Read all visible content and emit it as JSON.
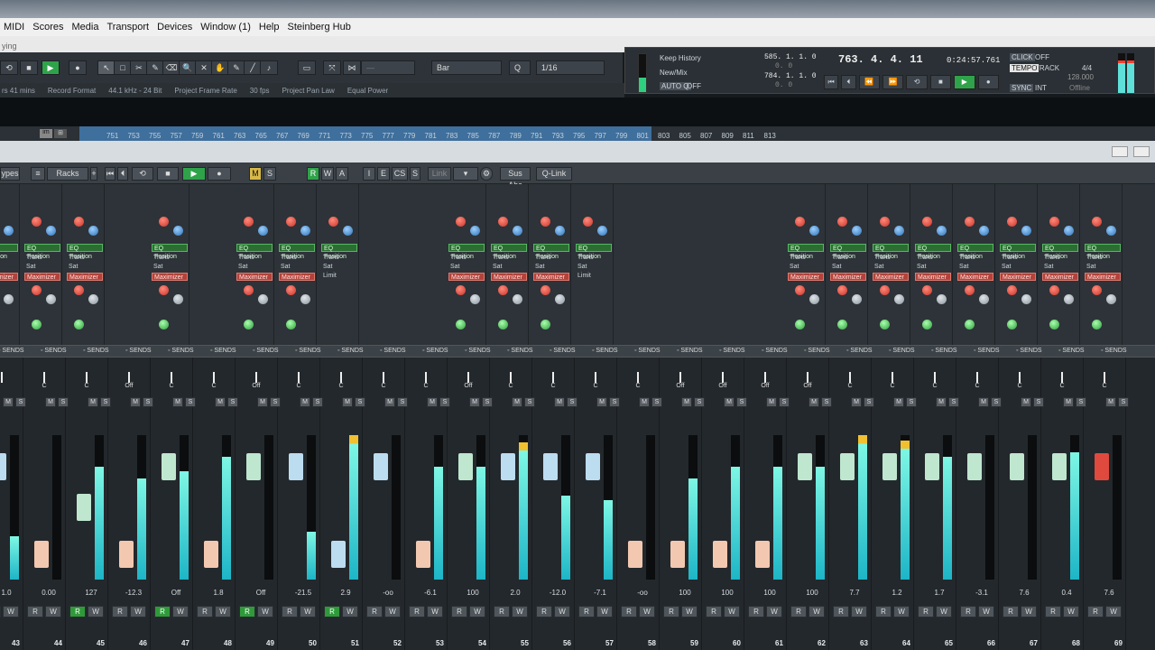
{
  "menu": [
    "MIDI",
    "Scores",
    "Media",
    "Transport",
    "Devices",
    "Window (1)",
    "Help",
    "Steinberg Hub"
  ],
  "subbar": "ying",
  "toolbar": {
    "quantize_label": "Bar",
    "grid_value": "1/16"
  },
  "project_info": [
    "rs 41 mins",
    "Record Format",
    "44.1 kHz - 24 Bit",
    "Project Frame Rate",
    "30 fps",
    "Project Pan Law",
    "Equal Power"
  ],
  "history": {
    "keep": "Keep History",
    "newmix": "New/Mix",
    "auto_q": "AUTO Q",
    "auto_q_state": "OFF"
  },
  "transport": {
    "left_locator": "585. 1. 1.  0",
    "left_sub": "0.  0",
    "right_locator": "784. 1. 1.  0",
    "right_sub": "0.  0",
    "position": "763. 4. 4. 11",
    "time": "0:24:57.761",
    "click": "CLICK",
    "click_state": "OFF",
    "tempo": "TEMPO",
    "tempo_mode": "TRACK",
    "signature": "4/4",
    "tempo_value": "128.000",
    "sync": "SYNC",
    "sync_mode": "INT",
    "sync_state": "Offline"
  },
  "ruler_ticks": [
    "751",
    "753",
    "755",
    "757",
    "759",
    "761",
    "763",
    "765",
    "767",
    "769",
    "771",
    "773",
    "775",
    "777",
    "779",
    "781",
    "783",
    "785",
    "787",
    "789",
    "791",
    "793",
    "795",
    "797",
    "799",
    "801",
    "803",
    "805",
    "807",
    "809",
    "811",
    "813"
  ],
  "mixer_toolbar": {
    "types": "ypes",
    "racks": "Racks",
    "link": "Link",
    "sus_abs": "Sus Abs",
    "qlink": "Q-Link",
    "m": "M",
    "s": "S",
    "r": "R",
    "w": "W",
    "a": "A",
    "i": "I",
    "e": "E",
    "cs": "CS"
  },
  "rack_labels": {
    "eq": "EQ Position",
    "trans": "Trans",
    "sat": "Sat",
    "limit": "Limit",
    "maximizer": "Maximizer"
  },
  "sends_label": "SENDS",
  "channels": [
    {
      "num": "43",
      "val": "1.0",
      "pan": "",
      "meter": 0.3,
      "fader": "#bcdcf0",
      "fpos": 0.85,
      "r": false
    },
    {
      "num": "44",
      "val": "0.00",
      "pan": "C",
      "meter": 0.0,
      "fader": "#f2c8b0",
      "fpos": 0.1,
      "r": false
    },
    {
      "num": "45",
      "val": "127",
      "pan": "C",
      "meter": 0.78,
      "fader": "#bfe6cf",
      "fpos": 0.5,
      "r": true
    },
    {
      "num": "46",
      "val": "-12.3",
      "pan": "Off",
      "meter": 0.7,
      "fader": "#f2c8b0",
      "fpos": 0.1,
      "r": false
    },
    {
      "num": "47",
      "val": "Off",
      "pan": "C",
      "meter": 0.75,
      "fader": "#bfe6cf",
      "fpos": 0.85,
      "r": true
    },
    {
      "num": "48",
      "val": "1.8",
      "pan": "C",
      "meter": 0.85,
      "fader": "#f2c8b0",
      "fpos": 0.1,
      "r": false
    },
    {
      "num": "49",
      "val": "Off",
      "pan": "Off",
      "meter": 0.0,
      "fader": "#bfe6cf",
      "fpos": 0.85,
      "r": true
    },
    {
      "num": "50",
      "val": "-21.5",
      "pan": "C",
      "meter": 0.33,
      "fader": "#bcdcf0",
      "fpos": 0.85,
      "r": false
    },
    {
      "num": "51",
      "val": "2.9",
      "pan": "C",
      "meter": 1.0,
      "fader": "#bcdcf0",
      "fpos": 0.1,
      "r": true
    },
    {
      "num": "52",
      "val": "-oo",
      "pan": "C",
      "meter": 0.0,
      "fader": "#bcdcf0",
      "fpos": 0.85,
      "r": false
    },
    {
      "num": "53",
      "val": "-6.1",
      "pan": "C",
      "meter": 0.78,
      "fader": "#f2c8b0",
      "fpos": 0.1,
      "r": false
    },
    {
      "num": "54",
      "val": "100",
      "pan": "Off",
      "meter": 0.78,
      "fader": "#bfe6cf",
      "fpos": 0.85,
      "r": false
    },
    {
      "num": "55",
      "val": "2.0",
      "pan": "C",
      "meter": 0.95,
      "fader": "#bcdcf0",
      "fpos": 0.85,
      "r": false
    },
    {
      "num": "56",
      "val": "-12.0",
      "pan": "C",
      "meter": 0.58,
      "fader": "#bcdcf0",
      "fpos": 0.85,
      "r": false
    },
    {
      "num": "57",
      "val": "-7.1",
      "pan": "C",
      "meter": 0.55,
      "fader": "#bcdcf0",
      "fpos": 0.85,
      "r": false
    },
    {
      "num": "58",
      "val": "-oo",
      "pan": "C",
      "meter": 0.0,
      "fader": "#f2c8b0",
      "fpos": 0.1,
      "r": false
    },
    {
      "num": "59",
      "val": "100",
      "pan": "Off",
      "meter": 0.7,
      "fader": "#f2c8b0",
      "fpos": 0.1,
      "r": false
    },
    {
      "num": "60",
      "val": "100",
      "pan": "Off",
      "meter": 0.78,
      "fader": "#f2c8b0",
      "fpos": 0.1,
      "r": false
    },
    {
      "num": "61",
      "val": "100",
      "pan": "Off",
      "meter": 0.78,
      "fader": "#f2c8b0",
      "fpos": 0.1,
      "r": false
    },
    {
      "num": "62",
      "val": "100",
      "pan": "Off",
      "meter": 0.78,
      "fader": "#bfe6cf",
      "fpos": 0.85,
      "r": false
    },
    {
      "num": "63",
      "val": "7.7",
      "pan": "C",
      "meter": 1.0,
      "fader": "#bfe6cf",
      "fpos": 0.85,
      "r": false
    },
    {
      "num": "64",
      "val": "1.2",
      "pan": "C",
      "meter": 0.96,
      "fader": "#bfe6cf",
      "fpos": 0.85,
      "r": false
    },
    {
      "num": "65",
      "val": "1.7",
      "pan": "C",
      "meter": 0.85,
      "fader": "#bfe6cf",
      "fpos": 0.85,
      "r": false
    },
    {
      "num": "66",
      "val": "-3.1",
      "pan": "C",
      "meter": 0.0,
      "fader": "#bfe6cf",
      "fpos": 0.85,
      "r": false
    },
    {
      "num": "67",
      "val": "7.6",
      "pan": "C",
      "meter": 0.0,
      "fader": "#bfe6cf",
      "fpos": 0.85,
      "r": false
    },
    {
      "num": "68",
      "val": "0.4",
      "pan": "C",
      "meter": 0.88,
      "fader": "#bfe6cf",
      "fpos": 0.85,
      "r": false
    },
    {
      "num": "69",
      "val": "7.6",
      "pan": "C",
      "meter": 0.0,
      "fader": "#e04a3e",
      "fpos": 0.85,
      "r": false
    }
  ]
}
